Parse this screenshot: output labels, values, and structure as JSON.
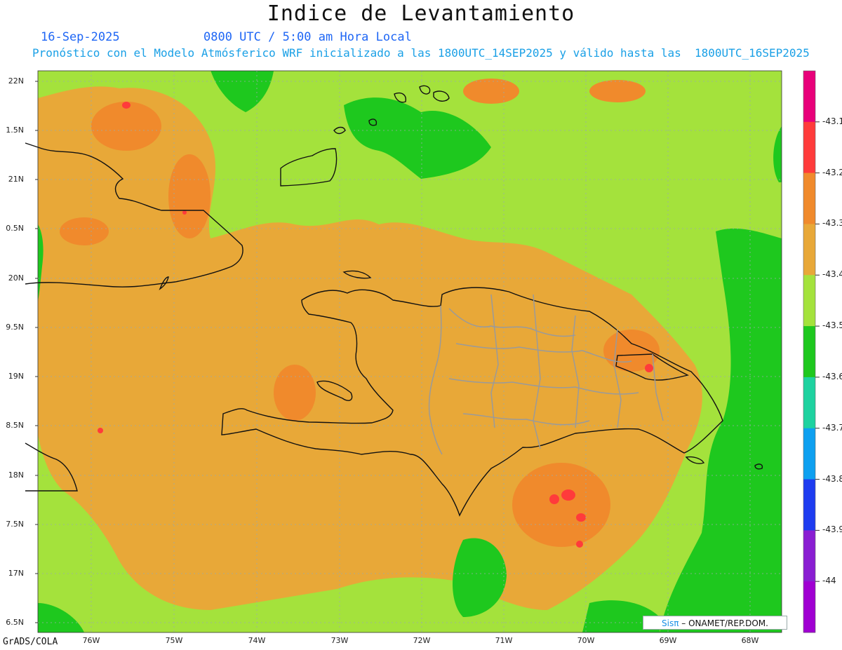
{
  "title": "Indice de Levantamiento",
  "date": "16-Sep-2025",
  "time": "0800 UTC / 5:00 am Hora Local",
  "subtitle": "Pronóstico con el Modelo Atmósferico WRF inicializado a las 1800UTC_14SEP2025 y válido hasta las  1800UTC_16SEP2025",
  "lat_labels": [
    "22N",
    "1.5N",
    "21N",
    "0.5N",
    "20N",
    "9.5N",
    "19N",
    "8.5N",
    "18N",
    "7.5N",
    "17N",
    "6.5N"
  ],
  "lon_labels": [
    "76W",
    "75W",
    "74W",
    "73W",
    "72W",
    "71W",
    "70W",
    "69W",
    "68W"
  ],
  "colorbar": {
    "labels": [
      "-43.1",
      "-43.2",
      "-43.3",
      "-43.4",
      "-43.5",
      "-43.6",
      "-43.7",
      "-43.8",
      "-43.9",
      "-44"
    ],
    "colors": [
      "#e8007a",
      "#ff3b3b",
      "#f08a2c",
      "#e8a838",
      "#a4e23c",
      "#1ec81e",
      "#1ed2a0",
      "#0ea0f0",
      "#1e3cf0",
      "#8a1ed2",
      "#a000d2"
    ]
  },
  "palette": {
    "lightgreen": "#a4e23c",
    "green": "#1ec81e",
    "orange_light": "#e8a838",
    "orange": "#f08a2c",
    "red": "#ff3b3b"
  },
  "footer": "GrADS/COLA",
  "credit": {
    "logo": "Sisπ",
    "text": " – ONAMET/REP.DOM."
  }
}
